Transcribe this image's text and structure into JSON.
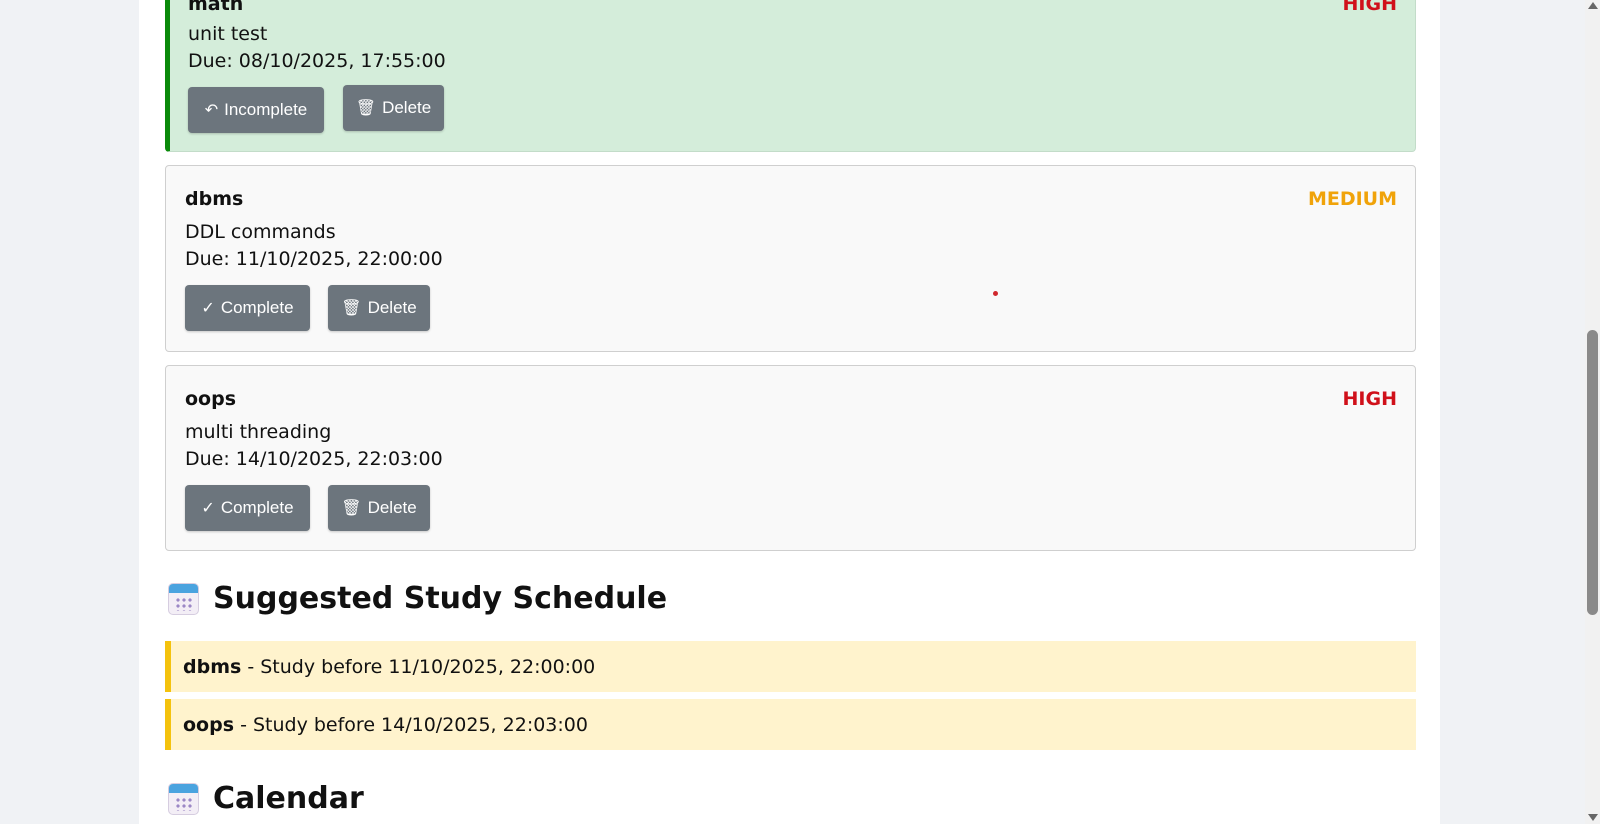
{
  "tasks": [
    {
      "title": "math",
      "desc": "unit test",
      "due": "Due: 08/10/2025, 17:55:00",
      "priority": "HIGH",
      "priority_color": "#d0101a",
      "state": "completed",
      "primary_btn": "Incomplete",
      "primary_icon": "↶",
      "delete_btn": "Delete",
      "delete_icon": "🗑"
    },
    {
      "title": "dbms",
      "desc": "DDL commands",
      "due": "Due: 11/10/2025, 22:00:00",
      "priority": "MEDIUM",
      "priority_color": "#f0a30a",
      "state": "pending",
      "primary_btn": "Complete",
      "primary_icon": "✓",
      "delete_btn": "Delete",
      "delete_icon": "🗑"
    },
    {
      "title": "oops",
      "desc": "multi threading",
      "due": "Due: 14/10/2025, 22:03:00",
      "priority": "HIGH",
      "priority_color": "#d0101a",
      "state": "pending",
      "primary_btn": "Complete",
      "primary_icon": "✓",
      "delete_btn": "Delete",
      "delete_icon": "🗑"
    }
  ],
  "schedule": {
    "heading": "Suggested Study Schedule",
    "icon": "calendar-icon",
    "items": [
      {
        "subject": "dbms",
        "text": " - Study before 11/10/2025, 22:00:00"
      },
      {
        "subject": "oops",
        "text": " - Study before 14/10/2025, 22:03:00"
      }
    ]
  },
  "calendar": {
    "heading": "Calendar",
    "icon": "calendar-icon"
  },
  "colors": {
    "completed_bg": "#d4edda",
    "completed_border": "#0a8a0a",
    "schedule_bg": "#fff3cd",
    "schedule_border": "#f4c20d",
    "button_bg": "#6c757d"
  }
}
